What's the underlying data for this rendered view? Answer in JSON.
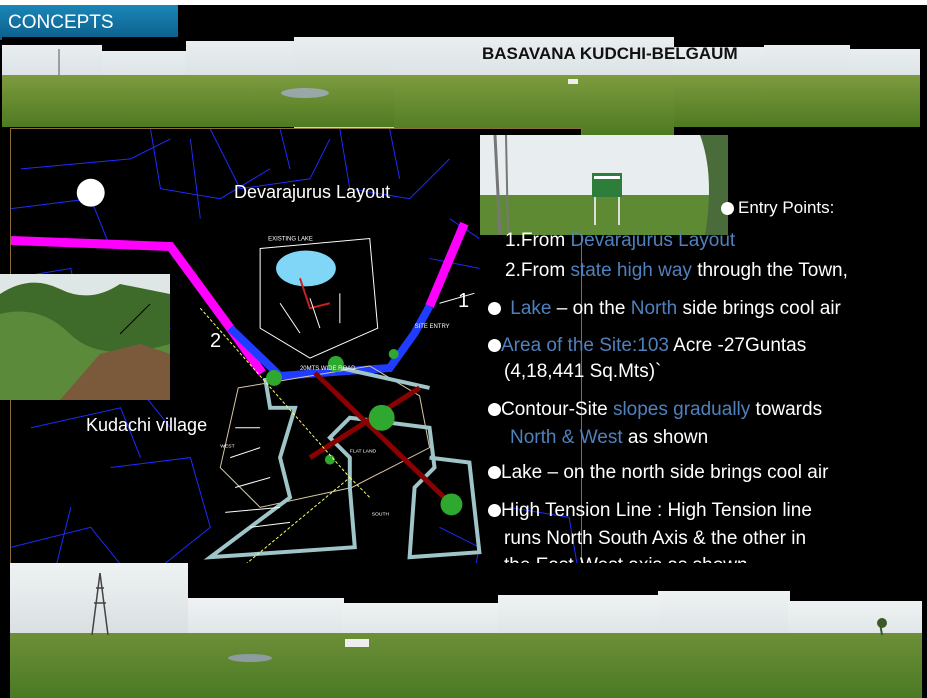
{
  "header": {
    "section_label": "CONCEPTS",
    "title": "BASAVANA KUDCHI-BELGAUM"
  },
  "map": {
    "label_layout": "Devarajurus Layout",
    "label_village": "Kudachi village",
    "label_lake": "EXISTING LAKE",
    "label_road": "20MTS WIDE ROAD",
    "label_site_entry": "SITE ENTRY",
    "label_flat": "FLAT LAND",
    "label_west": "WEST",
    "label_south": "SOUTH",
    "marker_1": "1",
    "marker_2": "2"
  },
  "points": {
    "entry_title": "Entry Points:",
    "entry_1_prefix": "1.From ",
    "entry_1_hl": "Devarajurus Layout",
    "entry_2_prefix": "2.From ",
    "entry_2_hl": "state high way",
    "entry_2_suffix": " through the Town,",
    "lake_hl1": "Lake",
    "lake_mid": " – on the ",
    "lake_hl2": "North",
    "lake_suffix": " side brings cool air",
    "area_hl": "Area of the Site:103",
    "area_suffix": " Acre  -27Guntas",
    "area_line2": "(4,18,441 Sq.Mts)`",
    "contour_prefix": "Contour-Site ",
    "contour_hl": "slopes gradually",
    "contour_suffix": " towards",
    "contour_line2_hl": "North & West",
    "contour_line2_suffix": " as shown",
    "lake2": "Lake – on the north side brings cool air",
    "ht_line1": "High Tension Line : High Tension line",
    "ht_line2": "runs North  South Axis & the other in",
    "ht_line3": "the East-West axis as shown"
  },
  "colors": {
    "highlight": "#4f81bd",
    "header_bg": "#1a86b8",
    "road_magenta": "#ff00ff",
    "road_blue": "#1f3cff"
  }
}
